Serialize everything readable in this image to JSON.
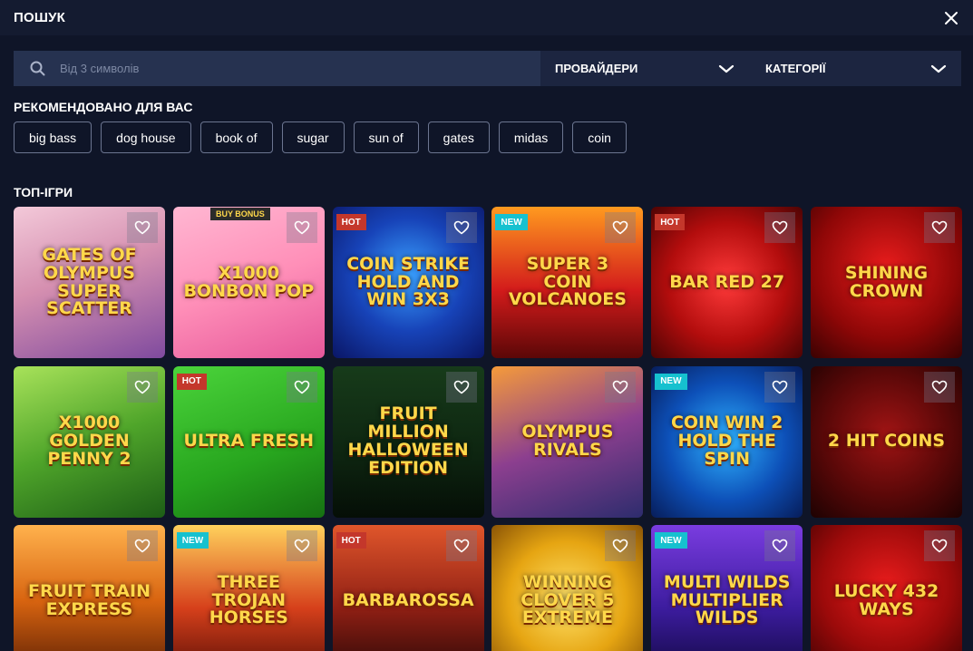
{
  "header": {
    "title": "ПОШУК"
  },
  "search": {
    "placeholder": "Від 3 символів",
    "value": ""
  },
  "filters": {
    "providers": "ПРОВАЙДЕРИ",
    "categories": "КАТЕГОРІЇ"
  },
  "recommended": {
    "title": "РЕКОМЕНДОВАНО ДЛЯ ВАС",
    "tags": [
      "big bass",
      "dog house",
      "book of",
      "sugar",
      "sun of",
      "gates",
      "midas",
      "coin"
    ]
  },
  "top": {
    "title": "ТОП-ІГРИ",
    "games": [
      {
        "title": "Gates of Olympus Super Scatter",
        "badge": "",
        "bg": "linear-gradient(160deg,#f3c9d9 0%,#d58fb0 45%,#7f4a9e 100%)"
      },
      {
        "title": "x1000 Bonbon Pop",
        "badge": "BUY BONUS",
        "bg": "linear-gradient(160deg,#ffb7d2 0%,#ff8fb8 50%,#e6579a 100%)"
      },
      {
        "title": "Coin Strike Hold and Win 3x3",
        "badge": "HOT",
        "bg": "radial-gradient(circle at 50% 45%,#3aa1ff 0%,#1743b8 50%,#0a1666 100%)"
      },
      {
        "title": "Super 3 Coin Volcanoes",
        "badge": "NEW",
        "bg": "linear-gradient(180deg,#ff9a1f 0%,#d31b1b 55%,#5b0707 100%)"
      },
      {
        "title": "Bar Red 27",
        "badge": "HOT",
        "bg": "radial-gradient(circle at 50% 50%,#ff3a3a 0%,#b30d0d 55%,#4d0404 100%)"
      },
      {
        "title": "Shining Crown",
        "badge": "",
        "bg": "radial-gradient(circle at 50% 40%,#e81c1c 0%,#8f0707 60%,#3a0202 100%)"
      },
      {
        "title": "x1000 Golden Penny 2",
        "badge": "",
        "bg": "linear-gradient(160deg,#a8e25a 0%,#4fa52a 50%,#1d5d16 100%)"
      },
      {
        "title": "Ultra Fresh",
        "badge": "HOT",
        "bg": "linear-gradient(160deg,#4bd43b 0%,#27a51e 60%,#167012 100%)"
      },
      {
        "title": "Fruit Million Halloween edition",
        "badge": "",
        "bg": "linear-gradient(180deg,#173b1a 0%,#0d2410 60%,#050e06 100%)"
      },
      {
        "title": "Olympus Rivals",
        "badge": "",
        "bg": "linear-gradient(160deg,#f59b3a 0%,#8c3f8f 50%,#2d2c6d 100%)"
      },
      {
        "title": "Coin Win 2 Hold the Spin",
        "badge": "NEW",
        "bg": "radial-gradient(circle at 50% 50%,#2fb3ff 0%,#0d50b8 55%,#071d5a 100%)"
      },
      {
        "title": "2 Hit Coins",
        "badge": "",
        "bg": "radial-gradient(circle at 50% 45%,#a01414 0%,#5a0808 55%,#1d0202 100%)"
      },
      {
        "title": "Fruit Train Express",
        "badge": "",
        "bg": "linear-gradient(180deg,#ffb24d 0%,#d86410 50%,#5a1e04 100%)"
      },
      {
        "title": "Three Trojan Horses",
        "badge": "NEW",
        "bg": "linear-gradient(180deg,#ffd15c 0%,#d6401b 55%,#5a0e06 100%)"
      },
      {
        "title": "Barbarossa",
        "badge": "HOT",
        "bg": "linear-gradient(180deg,#e0562b 0%,#8f1f14 55%,#2a0806 100%)"
      },
      {
        "title": "Winning Clover 5 Extreme",
        "badge": "",
        "bg": "radial-gradient(circle at 50% 50%,#ffe36b 0%,#e6a512 55%,#8a5406 100%)"
      },
      {
        "title": "Multi Wilds Multiplier Wilds",
        "badge": "NEW",
        "bg": "linear-gradient(180deg,#7a3ce0 0%,#3c1c9e 55%,#120842 100%)"
      },
      {
        "title": "Lucky 432 Ways",
        "badge": "",
        "bg": "radial-gradient(circle at 50% 40%,#e81c1c 0%,#9c0a0a 55%,#3d0202 100%)"
      }
    ]
  },
  "colors": {
    "hot": "#c4372b",
    "new": "#16c1cf",
    "accent": "#ffd84a"
  },
  "icons": {
    "search": "search-icon",
    "close": "close-icon",
    "chevron": "chevron-down-icon",
    "favorite": "heart-icon"
  }
}
